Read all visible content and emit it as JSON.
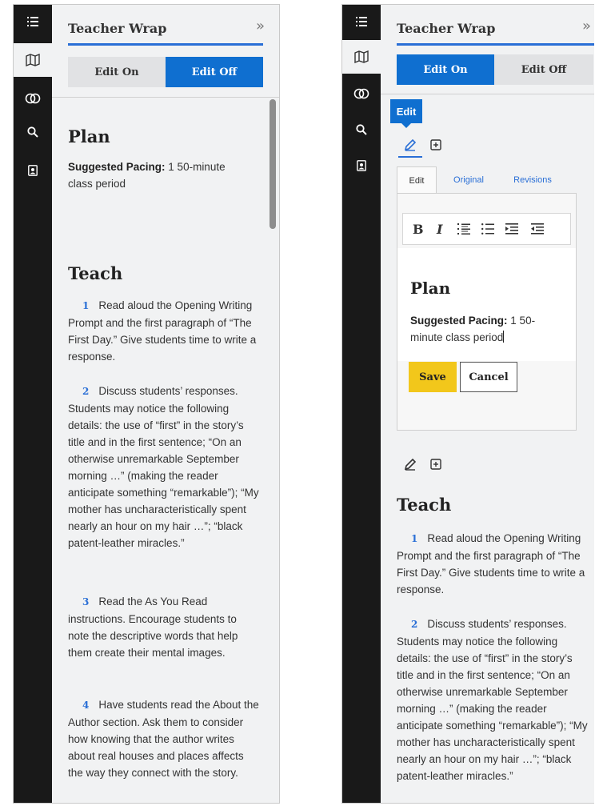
{
  "colors": {
    "accent": "#0f6fd0",
    "rail": "#191919",
    "save": "#f2c71b"
  },
  "rail_icons": [
    "list-icon",
    "map-icon",
    "rings-icon",
    "search-icon",
    "contact-card-icon"
  ],
  "header": {
    "title": "Teacher Wrap",
    "collapse": "»"
  },
  "toggle": {
    "on": "Edit On",
    "off": "Edit Off"
  },
  "plan": {
    "heading": "Plan",
    "pacing_label": "Suggested Pacing:",
    "pacing_value": "1 50-minute class period"
  },
  "teach": {
    "heading": "Teach",
    "steps": [
      {
        "num": "1",
        "text": "Read aloud the Opening Writing Prompt and the first paragraph of “The First Day.” Give students time to write a response."
      },
      {
        "num": "2",
        "text": "Discuss students’ responses. Students may notice the following details: the use of “first” in the story’s title and in the first sentence; “On an otherwise unremarkable September morning …” (making the reader anticipate something “remarkable”); “My mother has uncharacteristically spent nearly an hour on my hair …”; “black patent-leather miracles.”"
      },
      {
        "num": "3",
        "text": "Read the As You Read instructions. Encourage students to note the descriptive words that help them create their mental images."
      },
      {
        "num": "4",
        "text": "Have students read the About the Author section. Ask them to consider how knowing that the author writes about real houses and places affects the way they connect with the story."
      }
    ]
  },
  "editor": {
    "tooltip": "Edit",
    "tabs": [
      "Edit",
      "Original",
      "Revisions"
    ],
    "toolbar": {
      "bold": "B",
      "italic": "I"
    },
    "save": "Save",
    "cancel": "Cancel"
  }
}
